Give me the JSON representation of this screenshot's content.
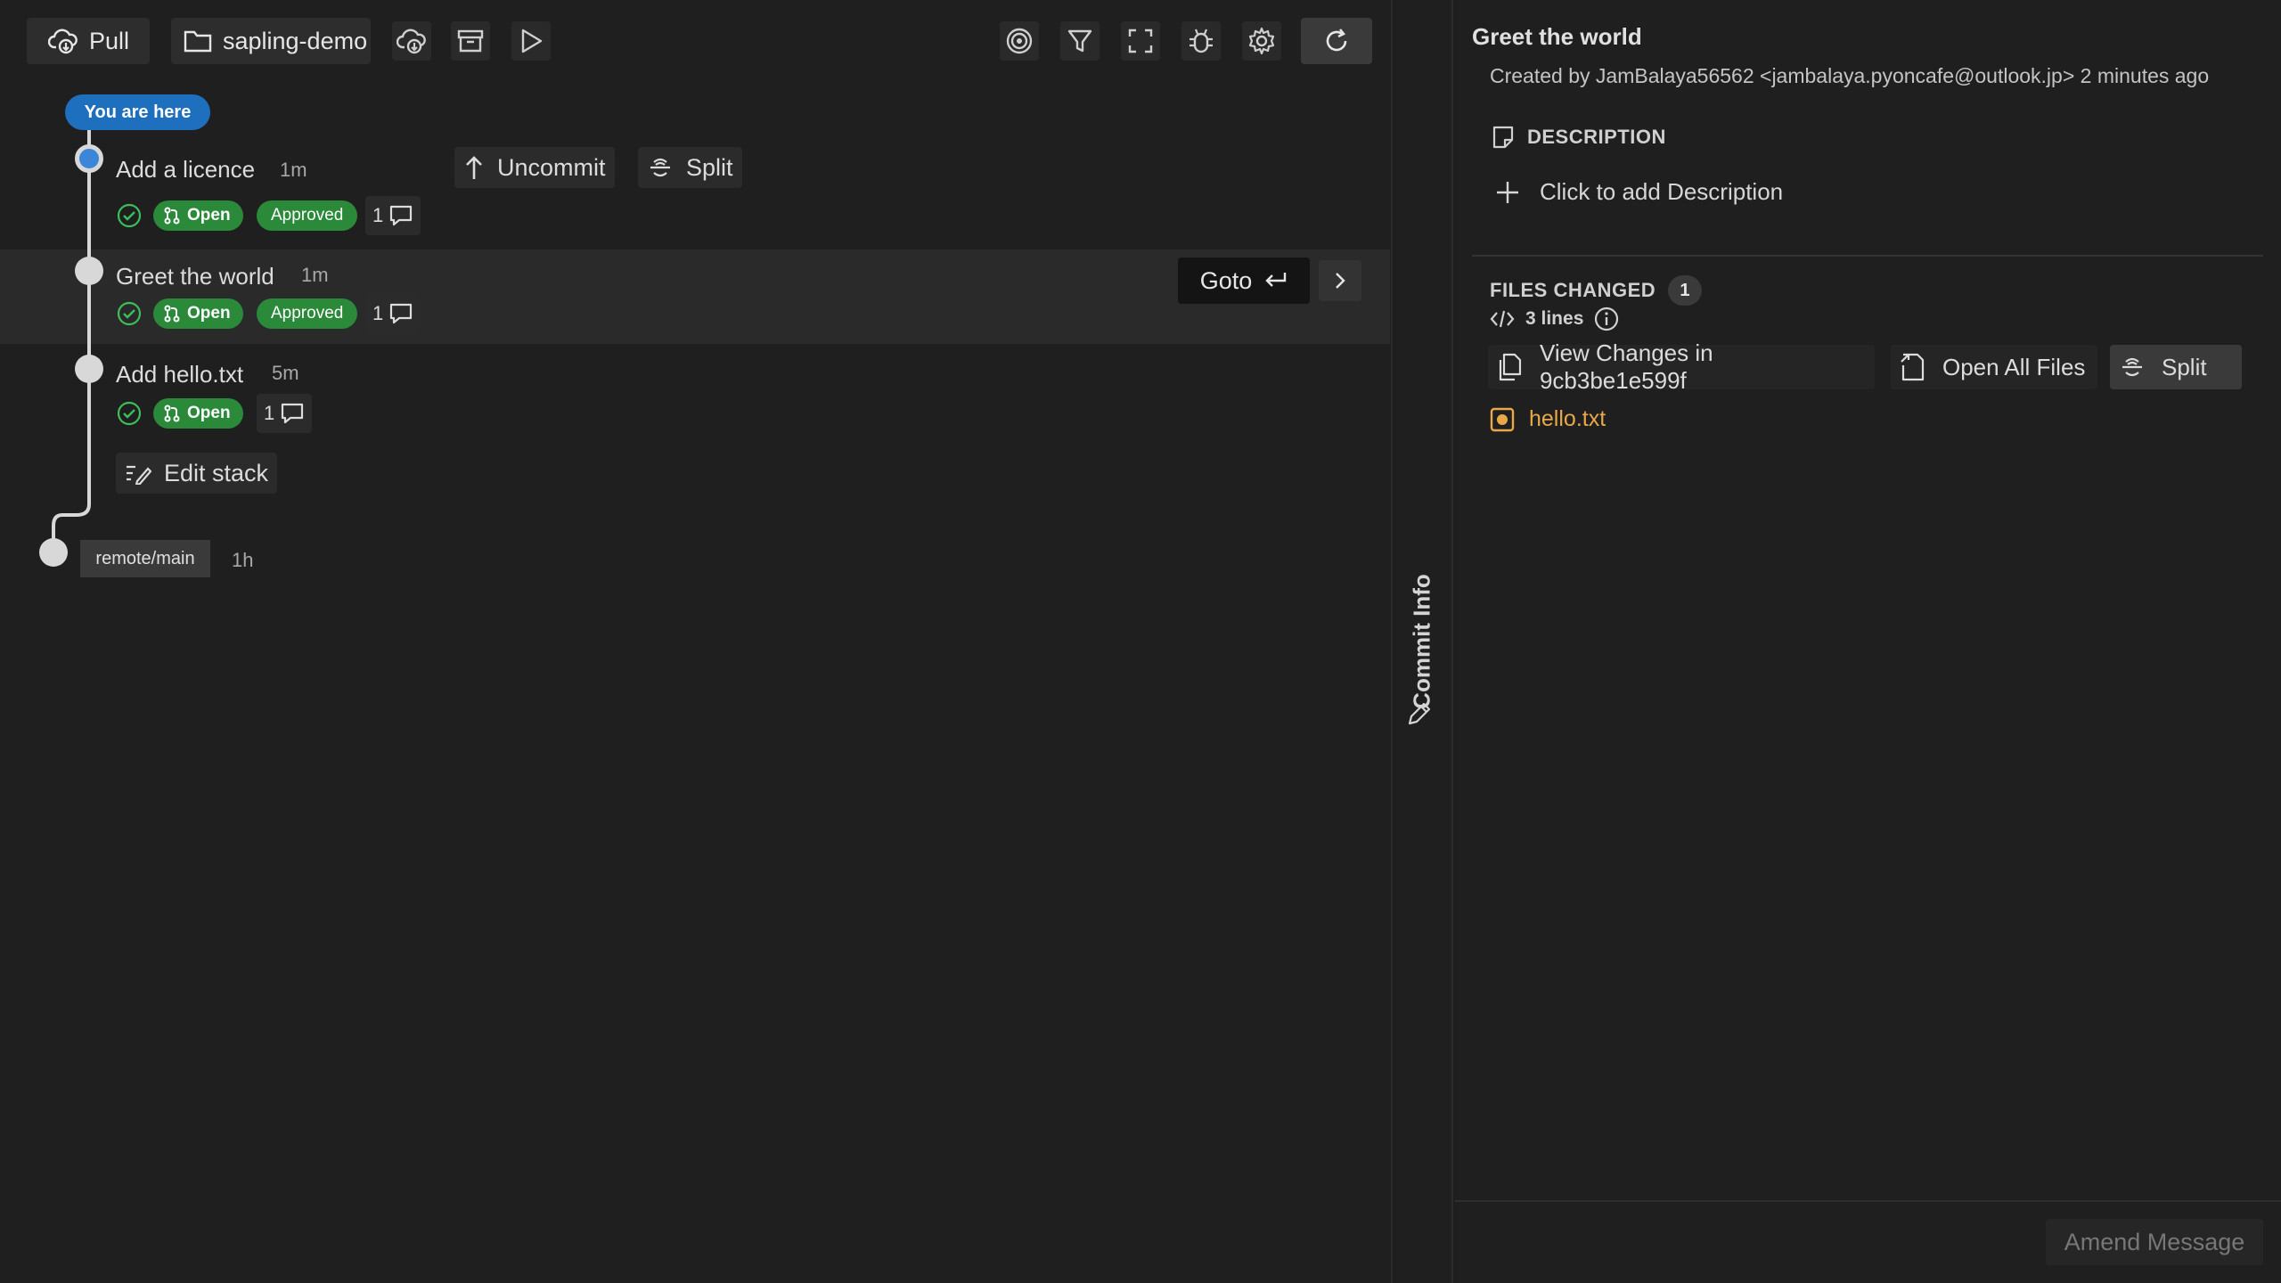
{
  "toolbar": {
    "pull_label": "Pull",
    "repo_label": "sapling-demo",
    "icons": [
      "cloud-download-icon",
      "archive-icon",
      "run-icon",
      "target-icon",
      "filter-icon",
      "fullscreen-icon",
      "bug-icon",
      "gear-icon",
      "refresh-icon"
    ]
  },
  "graph": {
    "you_are_here": "You are here",
    "commits": [
      {
        "title": "Add a licence",
        "age": "1m",
        "status": "Open",
        "review": "Approved",
        "comments": "1"
      },
      {
        "title": "Greet the world",
        "age": "1m",
        "status": "Open",
        "review": "Approved",
        "comments": "1"
      },
      {
        "title": "Add hello.txt",
        "age": "5m",
        "status": "Open",
        "comments": "1"
      }
    ],
    "actions": {
      "uncommit": "Uncommit",
      "split": "Split",
      "goto": "Goto"
    },
    "edit_stack": "Edit stack",
    "remote": {
      "label": "remote/main",
      "age": "1h"
    }
  },
  "commit_info": {
    "tab_label": "Commit Info",
    "title": "Greet the world",
    "created": "Created by JamBalaya56562 <jambalaya.pyoncafe@outlook.jp> 2 minutes ago",
    "description_header": "DESCRIPTION",
    "add_description": "Click to add Description",
    "files_changed_header": "FILES CHANGED",
    "files_changed_count": "1",
    "lines": "3 lines",
    "view_changes": "View Changes in 9cb3be1e599f",
    "open_all": "Open All Files",
    "split": "Split",
    "files": [
      {
        "name": "hello.txt",
        "status": "modified"
      }
    ],
    "amend": "Amend Message"
  },
  "colors": {
    "accent_blue": "#1f6fbf",
    "badge_green": "#2a8a3a",
    "check_green": "#3bbf5a",
    "modified_orange": "#e8a84a"
  }
}
